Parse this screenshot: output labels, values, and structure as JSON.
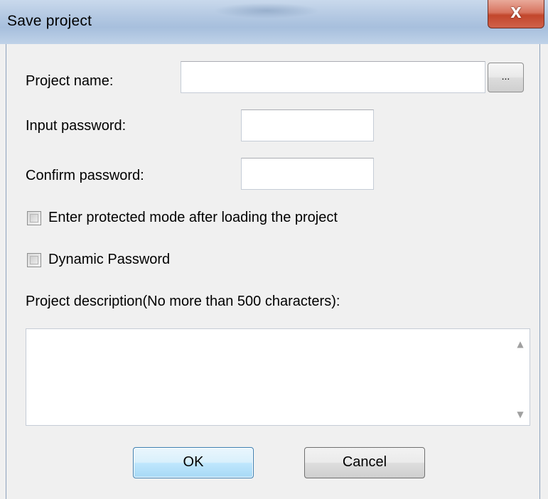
{
  "window": {
    "title": "Save project",
    "close_glyph": "X"
  },
  "form": {
    "project_name_label": "Project name:",
    "project_name_value": "",
    "browse_label": "...",
    "input_password_label": "Input password:",
    "input_password_value": "",
    "confirm_password_label": "Confirm password:",
    "confirm_password_value": "",
    "protected_mode_label": "Enter protected mode after loading the project",
    "protected_mode_checked": false,
    "dynamic_password_label": "Dynamic Password",
    "dynamic_password_checked": false,
    "description_label": "Project description(No more than 500 characters):",
    "description_value": ""
  },
  "buttons": {
    "ok_label": "OK",
    "cancel_label": "Cancel"
  },
  "icons": {
    "close": "close-icon",
    "scroll_up": "scroll-up-arrow-icon",
    "scroll_down": "scroll-down-arrow-icon"
  }
}
